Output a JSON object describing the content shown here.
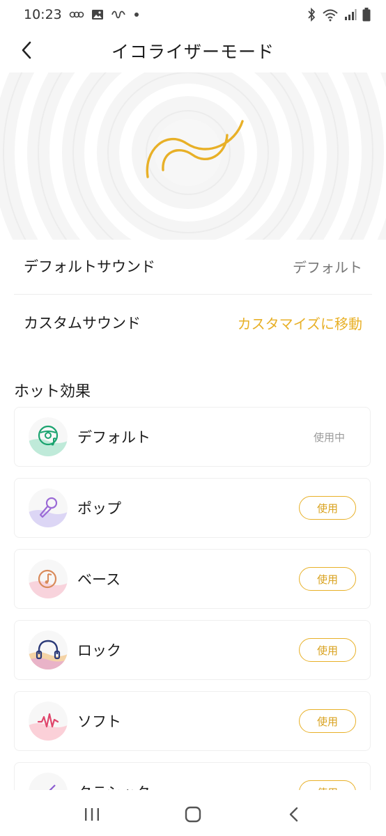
{
  "status_bar": {
    "time": "10:23",
    "icons": [
      "link-icon",
      "gallery-icon",
      "app-icon",
      "dot-icon",
      "bluetooth-icon",
      "wifi-icon",
      "signal-icon",
      "battery-icon"
    ]
  },
  "header": {
    "title": "イコライザーモード",
    "back_icon": "chevron-left-icon"
  },
  "hero": {
    "icon": "equalizer-wave-icon",
    "accent_color": "#e8b027"
  },
  "sound_settings": [
    {
      "label": "デフォルトサウンド",
      "value": "デフォルト"
    },
    {
      "label": "カスタムサウンド",
      "value": "カスタマイズに移動"
    }
  ],
  "hot_effects": {
    "title": "ホット効果",
    "items": [
      {
        "name": "デフォルト",
        "icon": "vinyl-disc-icon",
        "status": "使用中"
      },
      {
        "name": "ポップ",
        "icon": "microphone-icon",
        "action": "使用"
      },
      {
        "name": "ベース",
        "icon": "music-disc-icon",
        "action": "使用"
      },
      {
        "name": "ロック",
        "icon": "headphones-icon",
        "action": "使用"
      },
      {
        "name": "ソフト",
        "icon": "soundwave-icon",
        "action": "使用"
      },
      {
        "name": "クラシック",
        "icon": "violin-icon",
        "action": "使用"
      }
    ]
  },
  "nav_bar": {
    "recents_icon": "recents-icon",
    "home_icon": "home-icon",
    "back_icon": "back-icon"
  }
}
